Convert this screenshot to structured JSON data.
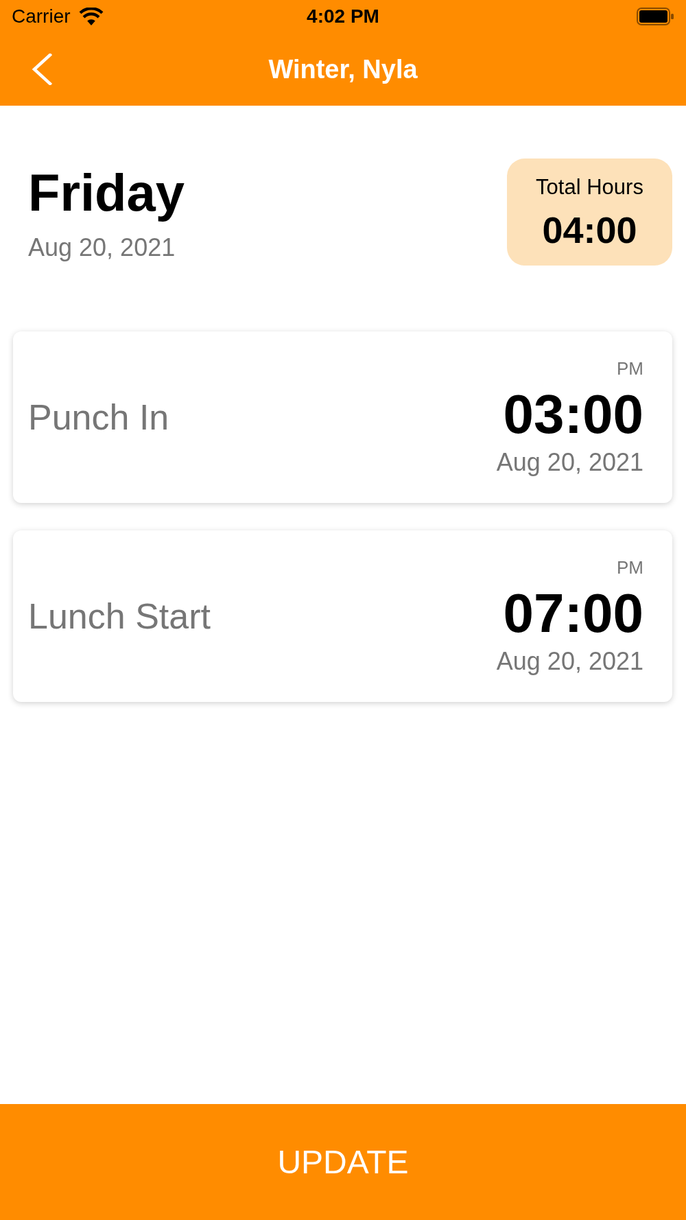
{
  "status_bar": {
    "carrier": "Carrier",
    "time": "4:02 PM"
  },
  "header": {
    "title": "Winter, Nyla"
  },
  "day": {
    "weekday": "Friday",
    "date": "Aug 20, 2021"
  },
  "total_hours": {
    "label": "Total Hours",
    "value": "04:00"
  },
  "entries": [
    {
      "label": "Punch In",
      "meridiem": "PM",
      "time": "03:00",
      "date": "Aug 20, 2021"
    },
    {
      "label": "Lunch Start",
      "meridiem": "PM",
      "time": "07:00",
      "date": "Aug 20, 2021"
    }
  ],
  "update_button": {
    "label": "UPDATE"
  }
}
